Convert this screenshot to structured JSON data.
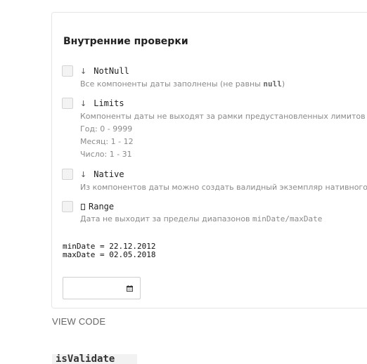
{
  "card": {
    "title": "Внутренние проверки",
    "checks": [
      {
        "name": "NotNull",
        "arrow": "↓",
        "desc_prefix": "Все компоненты даты заполнены (не равны ",
        "desc_code": "null",
        "desc_suffix": ")",
        "checked": false
      },
      {
        "name": "Limits",
        "arrow": "↓",
        "desc": "Компоненты даты не выходят за рамки предустановленных лимитов",
        "extra": [
          "Год: 0 - 9999",
          "Месяц: 1 - 12",
          "Число: 1 - 31"
        ],
        "checked": false
      },
      {
        "name": "Native",
        "arrow": "↓",
        "desc": "Из компонентов даты можно создать валидный экземпляр нативного",
        "checked": false
      },
      {
        "name": "Range",
        "desc_prefix": "Дата не выходит за пределы диапазонов ",
        "desc_code": "minDate/maxDate",
        "checked": false
      }
    ],
    "min_date_line": "minDate = 22.12.2012",
    "max_date_line": "maxDate = 02.05.2018",
    "date_input": {
      "value": "",
      "icon": "calendar-icon"
    }
  },
  "view_code_label": "VIEW CODE",
  "bottom_code_text": "isValidate"
}
